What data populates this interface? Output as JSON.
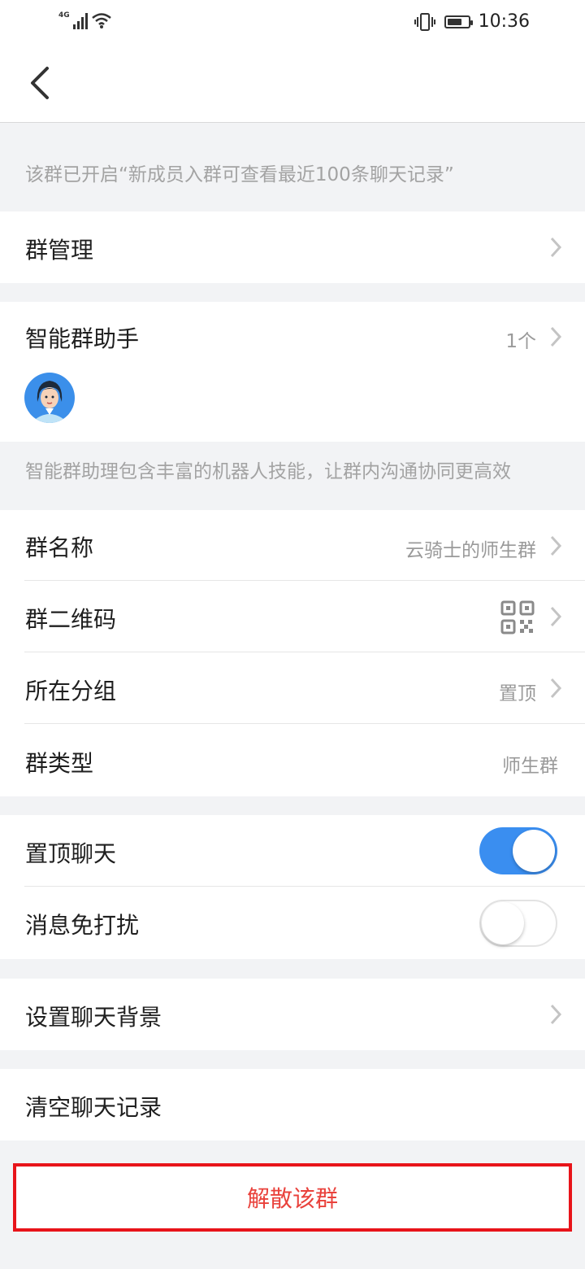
{
  "status_bar": {
    "network": "4G",
    "time": "10:36",
    "battery_level": 0.7,
    "icons": [
      "signal-icon",
      "wifi-icon",
      "vibrate-icon",
      "battery-icon"
    ]
  },
  "nav": {
    "back_icon": "chevron-left-icon"
  },
  "history_note": "该群已开启“新成员入群可查看最近100条聊天记录”",
  "group_management": {
    "label": "群管理"
  },
  "assistant": {
    "label": "智能群助手",
    "count": "1个",
    "description": "智能群助理包含丰富的机器人技能，让群内沟通协同更高效"
  },
  "info": {
    "name": {
      "label": "群名称",
      "value": "云骑士的师生群"
    },
    "qrcode": {
      "label": "群二维码",
      "icon": "qr-code-icon"
    },
    "group": {
      "label": "所在分组",
      "value": "置顶"
    },
    "type": {
      "label": "群类型",
      "value": "师生群"
    }
  },
  "toggles": {
    "pin": {
      "label": "置顶聊天",
      "on": true
    },
    "mute": {
      "label": "消息免打扰",
      "on": false
    }
  },
  "chat_background": {
    "label": "设置聊天背景"
  },
  "clear_history": {
    "label": "清空聊天记录"
  },
  "dissolve": {
    "label": "解散该群"
  },
  "colors": {
    "accent": "#3a8ef0",
    "danger_text": "#e9423c",
    "highlight_border": "#e8141a",
    "background": "#f2f3f5"
  }
}
